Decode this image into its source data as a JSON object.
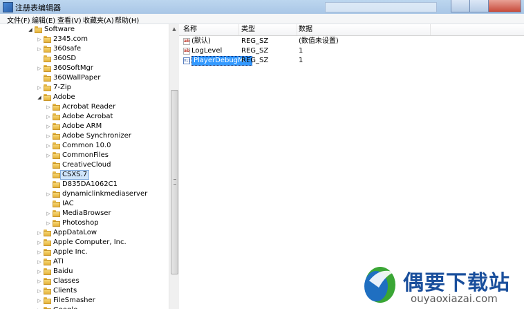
{
  "window": {
    "title": "注册表编辑器"
  },
  "menu": [
    {
      "label": "文件(F)"
    },
    {
      "label": "编辑(E)"
    },
    {
      "label": "查看(V)"
    },
    {
      "label": "收藏夹(A)"
    },
    {
      "label": "帮助(H)"
    }
  ],
  "tree": {
    "root": {
      "label": "Software",
      "expanded": true
    },
    "items": [
      {
        "label": "2345.com",
        "level": 1,
        "expanded": false
      },
      {
        "label": "360safe",
        "level": 1,
        "expanded": false
      },
      {
        "label": "360SD",
        "level": 1,
        "expanded": null
      },
      {
        "label": "360SoftMgr",
        "level": 1,
        "expanded": false
      },
      {
        "label": "360WallPaper",
        "level": 1,
        "expanded": null
      },
      {
        "label": "7-Zip",
        "level": 1,
        "expanded": false
      },
      {
        "label": "Adobe",
        "level": 1,
        "expanded": true
      },
      {
        "label": "Acrobat Reader",
        "level": 2,
        "expanded": false
      },
      {
        "label": "Adobe Acrobat",
        "level": 2,
        "expanded": false
      },
      {
        "label": "Adobe ARM",
        "level": 2,
        "expanded": false
      },
      {
        "label": "Adobe Synchronizer",
        "level": 2,
        "expanded": false
      },
      {
        "label": "Common 10.0",
        "level": 2,
        "expanded": false
      },
      {
        "label": "CommonFiles",
        "level": 2,
        "expanded": false
      },
      {
        "label": "CreativeCloud",
        "level": 2,
        "expanded": null
      },
      {
        "label": "CSXS.7",
        "level": 2,
        "expanded": null,
        "selected": true
      },
      {
        "label": "D835DA1062C1",
        "level": 2,
        "expanded": null
      },
      {
        "label": "dynamiclinkmediaserver",
        "level": 2,
        "expanded": false
      },
      {
        "label": "IAC",
        "level": 2,
        "expanded": null
      },
      {
        "label": "MediaBrowser",
        "level": 2,
        "expanded": false
      },
      {
        "label": "Photoshop",
        "level": 2,
        "expanded": false
      },
      {
        "label": "AppDataLow",
        "level": 1,
        "expanded": false
      },
      {
        "label": "Apple Computer, Inc.",
        "level": 1,
        "expanded": false
      },
      {
        "label": "Apple Inc.",
        "level": 1,
        "expanded": false
      },
      {
        "label": "ATI",
        "level": 1,
        "expanded": false
      },
      {
        "label": "Baidu",
        "level": 1,
        "expanded": false
      },
      {
        "label": "Classes",
        "level": 1,
        "expanded": false
      },
      {
        "label": "Clients",
        "level": 1,
        "expanded": false
      },
      {
        "label": "FileSmasher",
        "level": 1,
        "expanded": false
      },
      {
        "label": "Google",
        "level": 1,
        "expanded": false
      }
    ]
  },
  "values": {
    "columns": {
      "name": "名称",
      "type": "类型",
      "data": "数据"
    },
    "rows": [
      {
        "name": "(默认)",
        "type": "REG_SZ",
        "data": "(数值未设置)",
        "icon": "string-value-icon"
      },
      {
        "name": "LogLevel",
        "type": "REG_SZ",
        "data": "1",
        "icon": "string-value-icon"
      },
      {
        "name": "PlayerDebugM...",
        "type": "REG_SZ",
        "data": "1",
        "icon": "binary-value-icon",
        "selected": true
      }
    ]
  },
  "watermark": {
    "brand": "偶要下载站",
    "domain": "ouyaoxiazai.com"
  },
  "colors": {
    "selection": "#3399ff",
    "brand_blue": "#1a4f9c",
    "brand_green": "#3aa635"
  }
}
